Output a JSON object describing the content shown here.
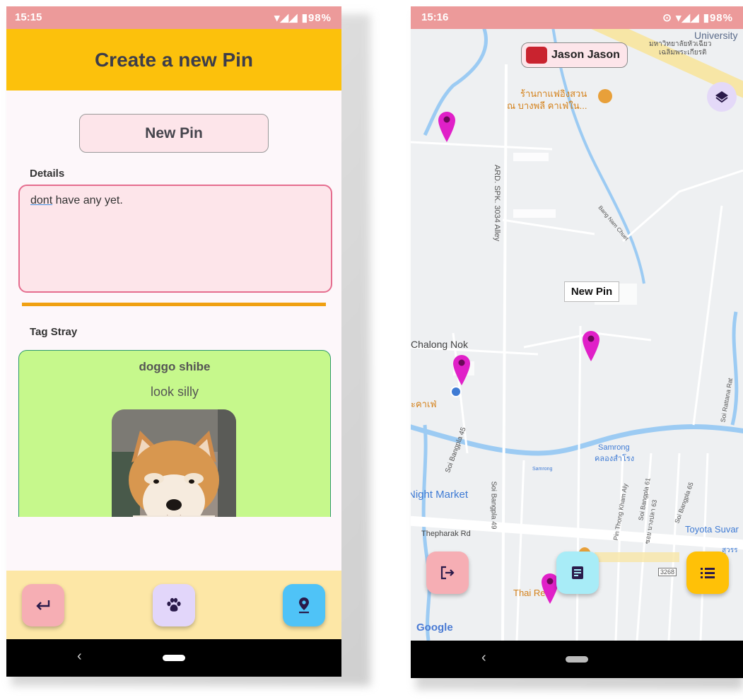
{
  "left": {
    "status": {
      "time": "15:15",
      "battery": "98%"
    },
    "app_title": "Create a new Pin",
    "pin_title": "New Pin",
    "details_label": "Details",
    "details_text_underlined": "dont",
    "details_text_rest": " have any yet.",
    "tag_label": "Tag Stray",
    "stray": {
      "name": "doggo shibe",
      "description": "look silly"
    },
    "buttons": {
      "back": "back-arrow-icon",
      "paw": "paw-icon",
      "location": "location-pin-icon"
    }
  },
  "right": {
    "status": {
      "time": "15:16",
      "battery": "98%"
    },
    "user_name": "Jason Jason",
    "marker_tooltip": "New Pin",
    "map_labels": {
      "university": "University",
      "university_th": "มหาวิทยาลัยหัวเฉียว",
      "university_th2": "เฉลิมพระเกียรติ",
      "cafe_th": "ร้านกาแฟอิงสวน",
      "cafe_th2": "ณ บางพลี คาเฟ่ใน...",
      "alley": "ARD. SPK. 3034 Alley",
      "bang_nam_chuet": "Bang Nam Chuet",
      "chalong_nok": "Chalong Nok",
      "cafe_fragment": "ะคาเฟ่",
      "soi_bangpla_45": "Soi Bangpla 45",
      "samrong": "Samrong",
      "samrong_th": "คลองสำโรง",
      "samrong_canal": "Samrong",
      "night_market": "Night Market",
      "soi_bangpla_49": "Soi Bangpla 49",
      "pin_thong": "Pin Thong Kham Aly",
      "soi_bangpla_61": "Soi Bangpla 61",
      "soi_bangpla_63": "ซอย บางปลา 63",
      "soi_bangpla_65": "Soi Bangpla 65",
      "soi_rattana": "Soi Rattana Rat",
      "toyota": "Toyota Suvar",
      "toyota_th": "สุวรร",
      "thepharak": "Thepharak Rd",
      "thai_re": "Thai Re",
      "route": "3268",
      "google": "Google"
    },
    "buttons": {
      "logout": "logout-icon",
      "notes": "notes-icon",
      "list": "list-icon"
    }
  },
  "colors": {
    "status_bar": "#ec9a9a",
    "app_bar": "#fcc10c",
    "pin_input": "#fde5ea",
    "details_border": "#e56d8f",
    "divider": "#f0a012",
    "stray_card": "#c6f88c",
    "bottom_bar": "#fde7a6",
    "marker": "#e020c8",
    "fab_back": "#f6aeb4",
    "fab_paw": "#e2d6fa",
    "fab_location": "#4fc3f7",
    "fab_notes": "#a8ecf7",
    "fab_list": "#ffc107"
  }
}
